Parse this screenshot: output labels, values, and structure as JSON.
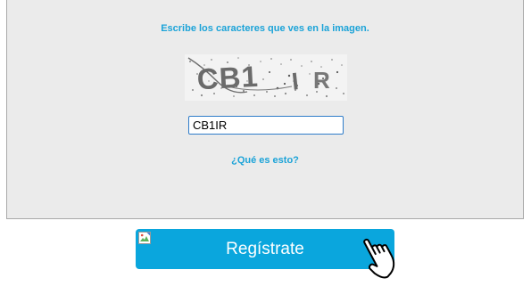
{
  "captcha": {
    "instruction": "Escribe los caracteres que ves en la imagen.",
    "image_text": "CB1IR",
    "input_value": "CB1IR",
    "help_link": "¿Qué es esto?"
  },
  "register": {
    "label": "Regístrate"
  },
  "icons": {
    "button_image": "broken-image-icon",
    "cursor": "hand-pointer-icon"
  },
  "colors": {
    "accent": "#1ba3d8",
    "button": "#0aa6dd",
    "panel": "#ebebeb",
    "input_border": "#2f7cc9"
  }
}
